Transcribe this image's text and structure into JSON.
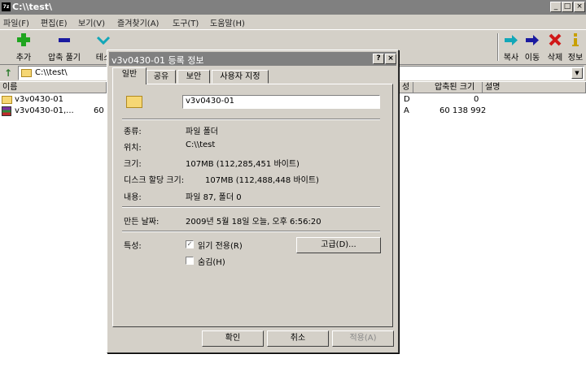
{
  "window": {
    "title": "C:\\\\test\\",
    "app_icon": "7z"
  },
  "menu": [
    "파일(F)",
    "편집(E)",
    "보기(V)",
    "즐겨찾기(A)",
    "도구(T)",
    "도움말(H)"
  ],
  "toolbar": {
    "add": "추가",
    "extract": "압축 풀기",
    "test": "테스",
    "copy": "복사",
    "move": "이동",
    "delete": "삭제",
    "info": "정보"
  },
  "address": {
    "path": "C:\\\\test\\"
  },
  "columns": {
    "name": "이름",
    "attr": "성",
    "packed_size": "압축된 크기",
    "comment": "설명"
  },
  "rows": [
    {
      "name": "v3v0430-01",
      "attr": "D",
      "packed": "0"
    },
    {
      "name": "v3v0430-01,...",
      "size_partial": "60",
      "attr": "A",
      "packed": "60 138 992"
    }
  ],
  "dialog": {
    "title": "v3v0430-01 등록 정보",
    "help_btn": "?",
    "close_btn": "×",
    "tabs": [
      "일반",
      "공유",
      "보안",
      "사용자 지정"
    ],
    "name_value": "v3v0430-01",
    "type_label": "종류:",
    "type_value": "파일 폴더",
    "location_label": "위치:",
    "location_value": "C:\\\\test",
    "size_label": "크기:",
    "size_value": "107MB (112,285,451 바이트)",
    "disk_label": "디스크 할당 크기:",
    "disk_value": "107MB (112,488,448 바이트)",
    "contents_label": "내용:",
    "contents_value": "파일 87, 폴더 0",
    "created_label": "만든 날짜:",
    "created_value": "2009년 5월 18일 오늘, 오후 6:56:20",
    "attributes_label": "특성:",
    "readonly_label": "읽기 전용(R)",
    "hidden_label": "숨김(H)",
    "advanced_btn": "고급(D)...",
    "ok_btn": "확인",
    "cancel_btn": "취소",
    "apply_btn": "적용(A)"
  }
}
